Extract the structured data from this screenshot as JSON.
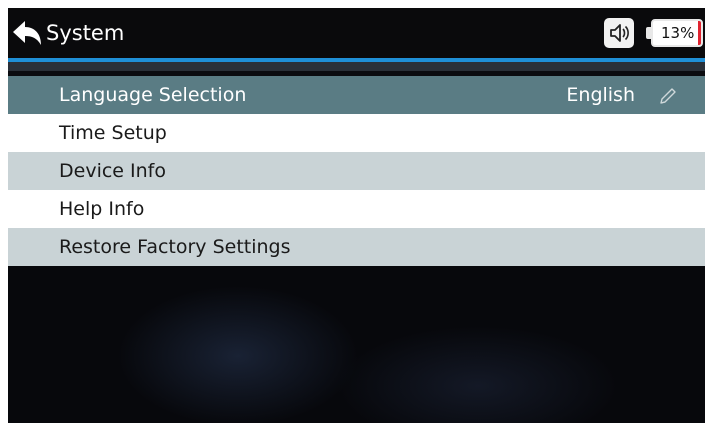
{
  "header": {
    "title": "System",
    "back_icon": "back-arrow-icon",
    "sound_icon": "speaker-icon",
    "battery_text": "13%",
    "battery_level": 0.13,
    "accent_color": "#1f8fd6"
  },
  "menu": {
    "items": [
      {
        "label": "Language Selection",
        "value": "English",
        "icon": "pencil-icon"
      },
      {
        "label": "Time Setup"
      },
      {
        "label": "Device Info"
      },
      {
        "label": "Help Info"
      },
      {
        "label": "Restore Factory Settings"
      }
    ]
  },
  "colors": {
    "selected_row": "#5a7c84",
    "alt_row": "#c9d3d6",
    "plain_row": "#ffffff",
    "battery_low": "#e0232f"
  }
}
